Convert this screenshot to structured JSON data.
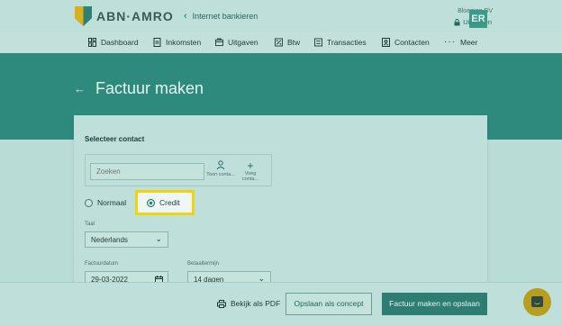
{
  "header": {
    "brand": "ABN·AMRO",
    "back_link": "Internet bankieren",
    "company": "Bloemen BV",
    "logout": "Uitloggen",
    "avatar_initials": "ER"
  },
  "nav": {
    "items": [
      {
        "label": "Dashboard",
        "icon": "dashboard-icon"
      },
      {
        "label": "Inkomsten",
        "icon": "document-icon"
      },
      {
        "label": "Uitgaven",
        "icon": "wallet-icon"
      },
      {
        "label": "Btw",
        "icon": "tax-icon"
      },
      {
        "label": "Transacties",
        "icon": "list-icon"
      },
      {
        "label": "Contacten",
        "icon": "contact-icon"
      },
      {
        "label": "Meer",
        "icon": "more-icon"
      }
    ]
  },
  "page": {
    "title": "Factuur maken",
    "back_arrow": "←"
  },
  "form": {
    "contact_section_title": "Selecteer contact",
    "search_placeholder": "Zoeken",
    "show_contact_label": "Toon conta...",
    "add_contact_label": "Voeg conta...",
    "radio_normal": "Normaal",
    "radio_credit": "Credit",
    "selected_type": "Credit",
    "language_label": "Taal",
    "language_value": "Nederlands",
    "invoice_date_label": "Factuurdatum",
    "invoice_date_value": "29-03-2022",
    "payment_term_label": "Betaaltermijn",
    "payment_term_value": "14 dagen"
  },
  "footer": {
    "pdf_label": "Bekijk als PDF",
    "save_concept_label": "Opslaan als concept",
    "create_save_label": "Factuur maken en opslaan"
  },
  "colors": {
    "hero": "#2e8a7d",
    "primary_button": "#2e7d72",
    "highlight": "#f2d40e",
    "chat_button": "#b89e1e"
  }
}
